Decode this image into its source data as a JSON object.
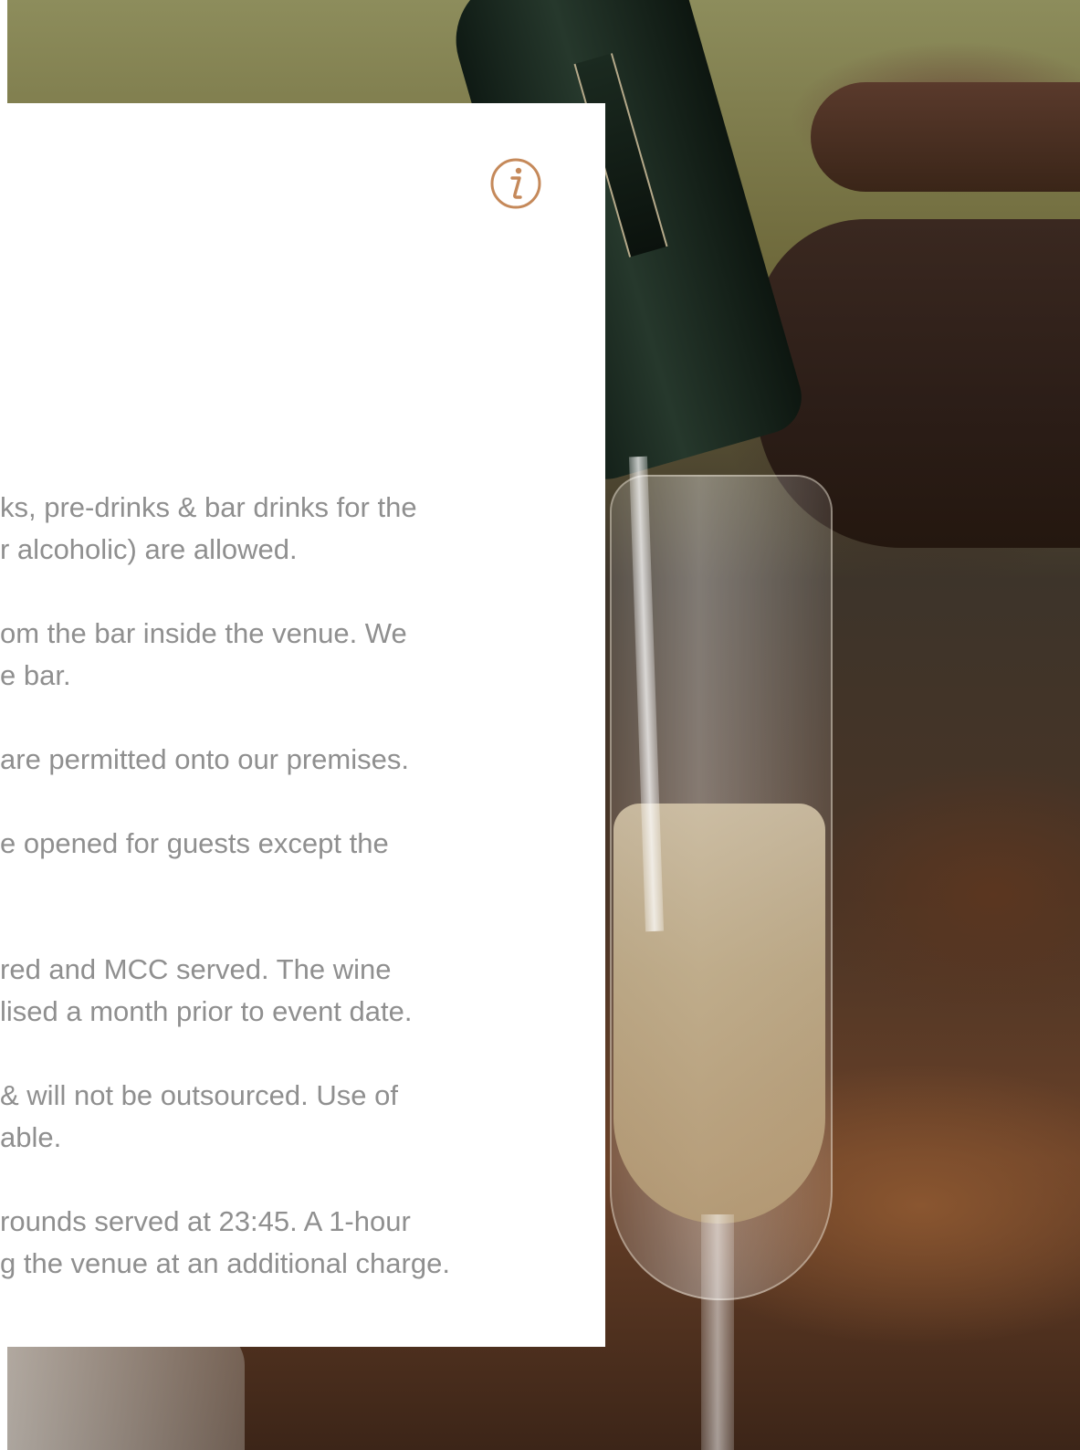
{
  "panel": {
    "info_icon": "info-circle-icon",
    "accent_color": "#c5895a",
    "text_color": "#8f8f8f",
    "rules": [
      {
        "line1": "ks, pre-drinks & bar drinks for the",
        "line2": "r alcoholic) are allowed."
      },
      {
        "line1": "om the bar inside the venue. We",
        "line2": "e bar."
      },
      {
        "line1": "are permitted onto our premises.",
        "line2": ""
      },
      {
        "line1": "e opened for guests except the",
        "line2": ""
      },
      {
        "line1": "red and MCC served. The wine",
        "line2": "lised a month prior to event date."
      },
      {
        "line1": "& will not be outsourced. Use of",
        "line2": "able."
      },
      {
        "line1": "rounds served at 23:45. A 1-hour",
        "line2": "g the venue at an additional charge."
      }
    ]
  }
}
